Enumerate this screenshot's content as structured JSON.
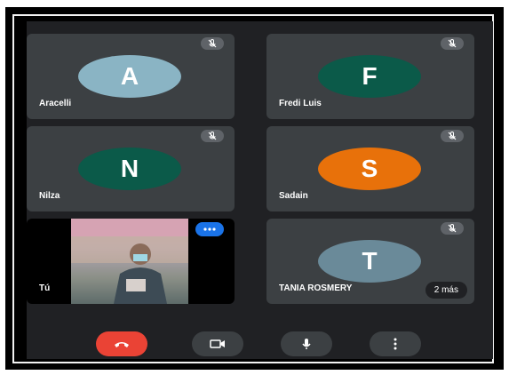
{
  "participants": [
    {
      "name": "Aracelli",
      "initial": "A",
      "color": "#8ab4c4"
    },
    {
      "name": "Fredi Luis",
      "initial": "F",
      "color": "#0b5a49"
    },
    {
      "name": "Nilza",
      "initial": "N",
      "color": "#0b5a49"
    },
    {
      "name": "Sadain",
      "initial": "S",
      "color": "#e8710a"
    },
    {
      "name": "Tú"
    },
    {
      "name": "TANIA ROSMERY",
      "initial": "T",
      "color": "#6a8a99",
      "extra": "2 más"
    }
  ],
  "controls": {
    "end_call": "phone-hangup-icon",
    "camera": "video-camera-icon",
    "microphone": "microphone-icon",
    "more": "more-vertical-icon"
  }
}
